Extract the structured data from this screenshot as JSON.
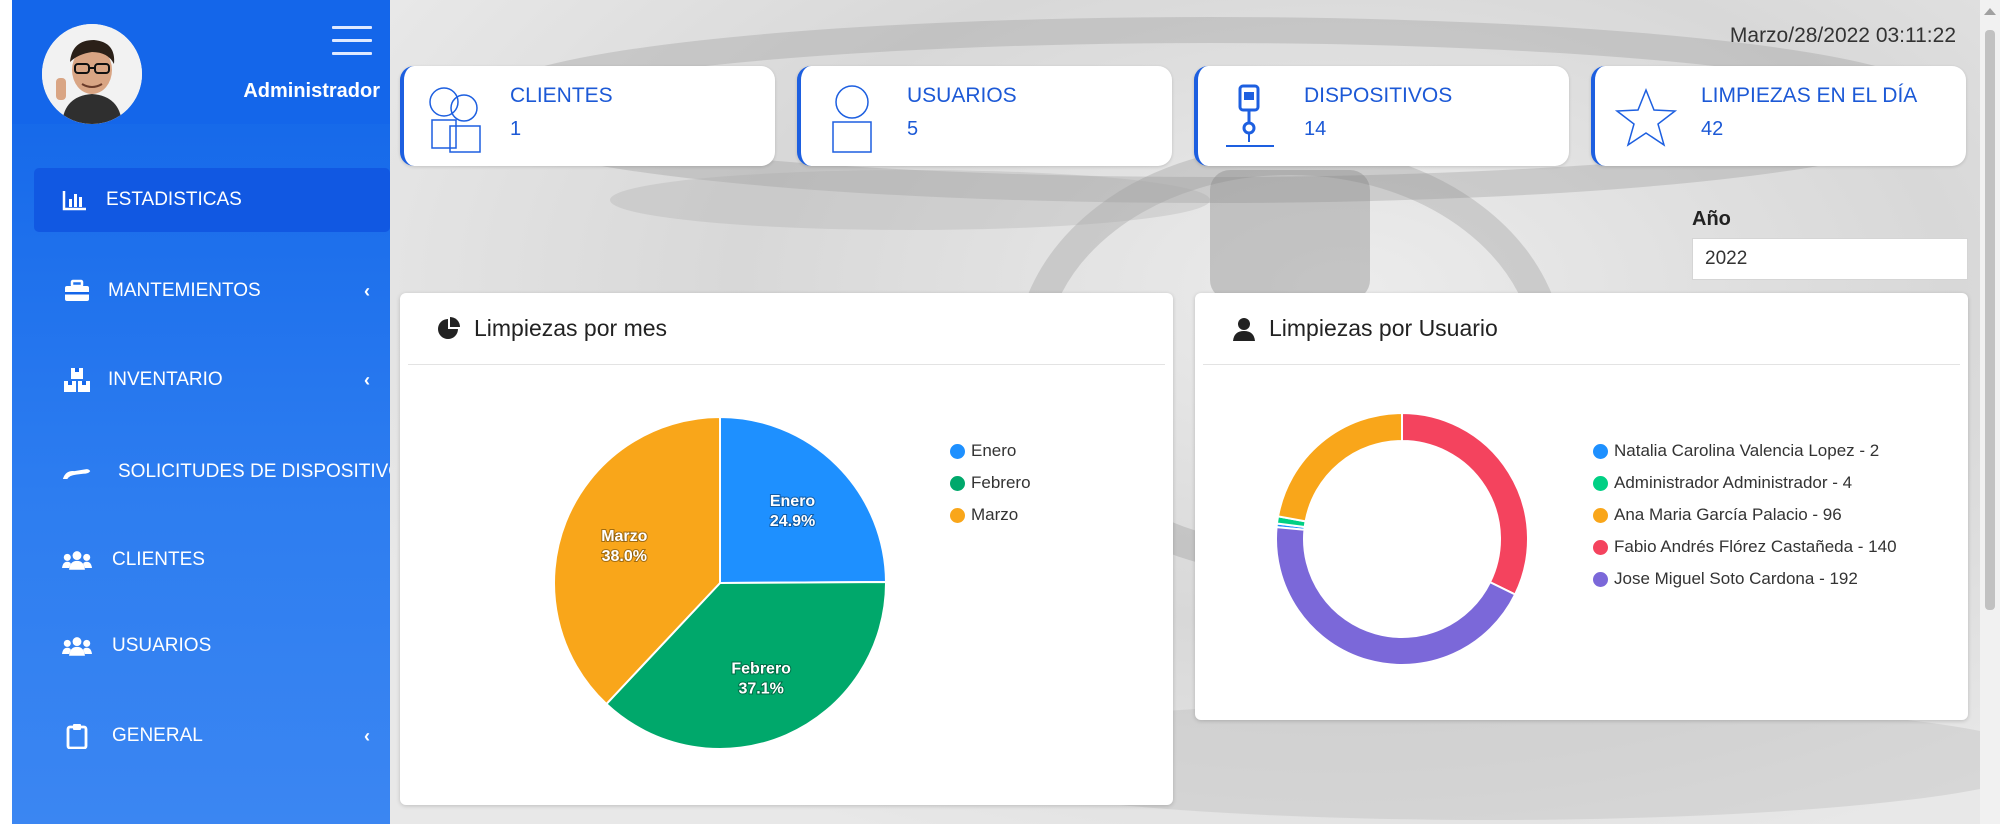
{
  "sidebar": {
    "user_name": "Administrador",
    "items": [
      {
        "label": "ESTADISTICAS",
        "icon": "bar-chart-icon",
        "has_caret": false,
        "active": true
      },
      {
        "label": "MANTEMIENTOS",
        "icon": "toolbox-icon",
        "has_caret": true,
        "active": false
      },
      {
        "label": "INVENTARIO",
        "icon": "boxes-icon",
        "has_caret": true,
        "active": false
      },
      {
        "label": "SOLICITUDES DE DISPOSITIVOS",
        "icon": "hand-icon",
        "has_caret": false,
        "active": false
      },
      {
        "label": "CLIENTES",
        "icon": "users-icon",
        "has_caret": false,
        "active": false
      },
      {
        "label": "USUARIOS",
        "icon": "users-icon",
        "has_caret": false,
        "active": false
      },
      {
        "label": "GENERAL",
        "icon": "clipboard-icon",
        "has_caret": true,
        "active": false
      }
    ],
    "caret_glyph": "‹"
  },
  "header": {
    "datetime": "Marzo/28/2022 03:11:22"
  },
  "stats": [
    {
      "title": "CLIENTES",
      "value": "1",
      "icon": "clients-icon"
    },
    {
      "title": "USUARIOS",
      "value": "5",
      "icon": "user-icon"
    },
    {
      "title": "DISPOSITIVOS",
      "value": "14",
      "icon": "device-icon"
    },
    {
      "title": "LIMPIEZAS EN EL DÍA",
      "value": "42",
      "icon": "star-icon"
    }
  ],
  "filter": {
    "year_label": "Año",
    "year_value": "2022"
  },
  "panels": {
    "by_month_title": "Limpiezas por mes",
    "by_user_title": "Limpiezas por Usuario"
  },
  "colors": {
    "accent": "#1466ea",
    "enero": "#1e90ff",
    "febrero": "#00a86b",
    "marzo": "#f9a61a",
    "user_blue": "#1e90ff",
    "user_green": "#00d084",
    "user_orange": "#f9a61a",
    "user_red": "#f4435e",
    "user_purple": "#7b68d9"
  },
  "chart_data": [
    {
      "type": "pie",
      "title": "Limpiezas por mes",
      "categories": [
        "Enero",
        "Febrero",
        "Marzo"
      ],
      "values": [
        24.9,
        37.1,
        38.0
      ],
      "labels": [
        "24.9%",
        "37.1%",
        "38.0%"
      ],
      "colors": [
        "#1e90ff",
        "#00a86b",
        "#f9a61a"
      ],
      "legend": "right"
    },
    {
      "type": "pie",
      "variant": "donut",
      "title": "Limpiezas por Usuario",
      "categories": [
        "Natalia Carolina Valencia Lopez - 2",
        "Administrador Administrador - 4",
        "Ana Maria García Palacio - 96",
        "Fabio Andrés Flórez Castañeda - 140",
        "Jose Miguel Soto Cardona - 192"
      ],
      "values": [
        2,
        4,
        96,
        140,
        192
      ],
      "colors": [
        "#1e90ff",
        "#00d084",
        "#f9a61a",
        "#f4435e",
        "#7b68d9"
      ],
      "legend": "right"
    }
  ]
}
